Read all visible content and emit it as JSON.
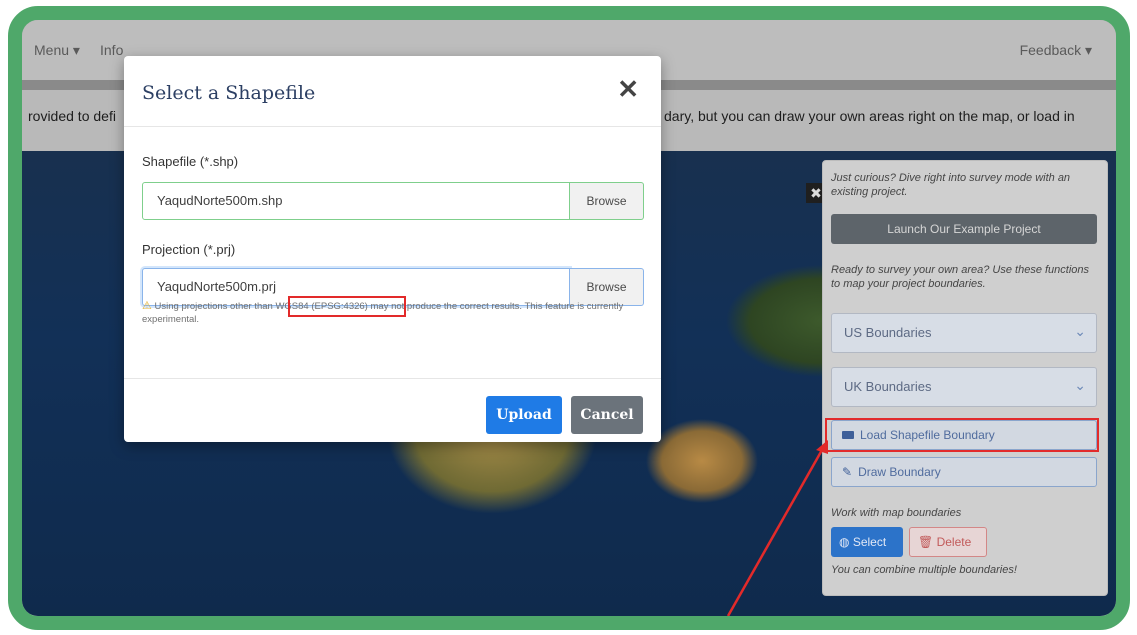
{
  "navbar": {
    "menu_label": "Menu ▾",
    "info_label": "Info",
    "feedback_label": "Feedback ▾"
  },
  "intro": {
    "left_text": "rovided to defi",
    "right_text": "dary, but you can draw your own areas right on the map, or load in"
  },
  "map": {
    "close_glyph": "✖"
  },
  "panel": {
    "curious_text": "Just curious? Dive right into survey mode with an existing project.",
    "launch_button": "Launch Our Example Project",
    "ready_text": "Ready to survey your own area? Use these functions to map your project boundaries.",
    "us_boundaries": "US Boundaries",
    "uk_boundaries": "UK Boundaries",
    "load_shapefile": "Load Shapefile Boundary",
    "draw_boundary": "Draw Boundary",
    "work_with_text": "Work with map boundaries",
    "select_button": "Select",
    "delete_button": "Delete",
    "combine_text": "You can combine multiple boundaries!"
  },
  "modal": {
    "title": "Select a Shapefile",
    "close_glyph": "✕",
    "shp_label": "Shapefile (*.shp)",
    "shp_value": "YaqudNorte500m.shp",
    "prj_label": "Projection (*.prj)",
    "prj_value": "YaqudNorte500m.prj",
    "browse_label": "Browse",
    "warning_prefix": "Using projections other than",
    "warning_highlight": "WGS84 (EPSG:4326)",
    "warning_suffix": "may not produce the correct results. This feature is currently experimental.",
    "upload_button": "Upload",
    "cancel_button": "Cancel"
  },
  "colors": {
    "frame_green": "#4fa86a",
    "highlight_red": "#e22a2a",
    "primary_blue": "#1f7be6",
    "secondary_gray": "#6b737b"
  }
}
